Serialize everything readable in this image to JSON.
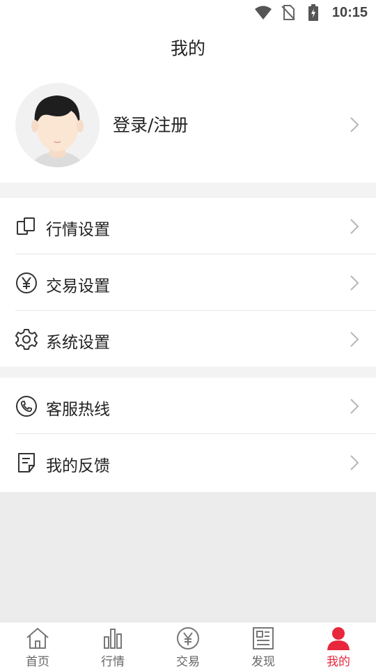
{
  "status_bar": {
    "time": "10:15",
    "icons": [
      "wifi-icon",
      "no-sim-icon",
      "battery-charging-icon"
    ]
  },
  "header": {
    "title": "我的"
  },
  "profile": {
    "login_label": "登录/注册",
    "avatar_icon": "user-avatar"
  },
  "settings_group": {
    "items": [
      {
        "label": "行情设置",
        "icon": "market-settings-icon"
      },
      {
        "label": "交易设置",
        "icon": "yen-circle-icon"
      },
      {
        "label": "系统设置",
        "icon": "gear-icon"
      }
    ]
  },
  "support_group": {
    "items": [
      {
        "label": "客服热线",
        "icon": "phone-icon"
      },
      {
        "label": "我的反馈",
        "icon": "feedback-icon"
      }
    ]
  },
  "tabbar": {
    "tabs": [
      {
        "label": "首页",
        "icon": "home-icon",
        "active": false
      },
      {
        "label": "行情",
        "icon": "bar-chart-icon",
        "active": false
      },
      {
        "label": "交易",
        "icon": "yen-circle-icon",
        "active": false
      },
      {
        "label": "发现",
        "icon": "news-icon",
        "active": false
      },
      {
        "label": "我的",
        "icon": "person-icon",
        "active": true
      }
    ]
  },
  "colors": {
    "accent": "#e8263c",
    "background": "#ececec",
    "text": "#222222",
    "muted": "#666666"
  }
}
